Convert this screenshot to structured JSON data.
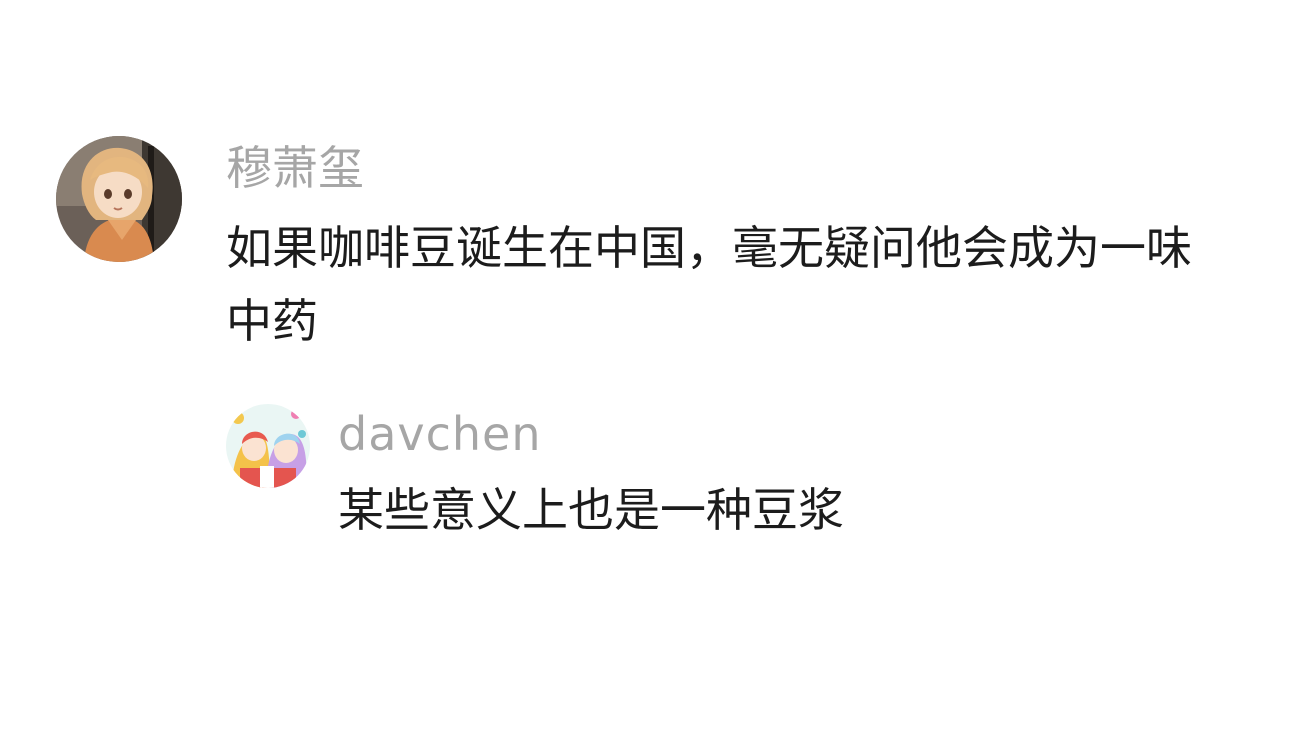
{
  "comment": {
    "username": "穆萧玺",
    "text": "如果咖啡豆诞生在中国，毫无疑问他会成为一味中药",
    "avatar_icon": "anime-character-avatar"
  },
  "reply": {
    "username": "davchen",
    "text": "某些意义上也是一种豆浆",
    "avatar_icon": "anime-duo-avatar"
  },
  "colors": {
    "background": "#ffffff",
    "username": "#a6a6a6",
    "text": "#1c1c1c"
  }
}
